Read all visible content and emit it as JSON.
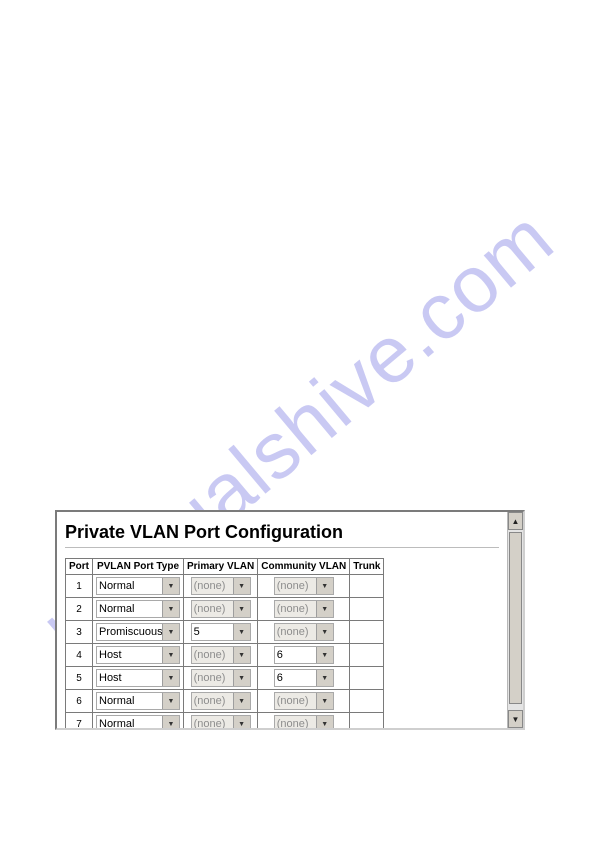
{
  "watermark": "manualshive.com",
  "panel": {
    "title": "Private VLAN Port Configuration",
    "columns": [
      "Port",
      "PVLAN Port Type",
      "Primary VLAN",
      "Community VLAN",
      "Trunk"
    ],
    "rows": [
      {
        "port": "1",
        "type": "Normal",
        "primary": "(none)",
        "primary_disabled": true,
        "community": "(none)",
        "community_disabled": true,
        "trunk": ""
      },
      {
        "port": "2",
        "type": "Normal",
        "primary": "(none)",
        "primary_disabled": true,
        "community": "(none)",
        "community_disabled": true,
        "trunk": ""
      },
      {
        "port": "3",
        "type": "Promiscuous",
        "primary": "5",
        "primary_disabled": false,
        "community": "(none)",
        "community_disabled": true,
        "trunk": ""
      },
      {
        "port": "4",
        "type": "Host",
        "primary": "(none)",
        "primary_disabled": true,
        "community": "6",
        "community_disabled": false,
        "trunk": ""
      },
      {
        "port": "5",
        "type": "Host",
        "primary": "(none)",
        "primary_disabled": true,
        "community": "6",
        "community_disabled": false,
        "trunk": ""
      },
      {
        "port": "6",
        "type": "Normal",
        "primary": "(none)",
        "primary_disabled": true,
        "community": "(none)",
        "community_disabled": true,
        "trunk": ""
      },
      {
        "port": "7",
        "type": "Normal",
        "primary": "(none)",
        "primary_disabled": true,
        "community": "(none)",
        "community_disabled": true,
        "trunk": ""
      }
    ]
  }
}
